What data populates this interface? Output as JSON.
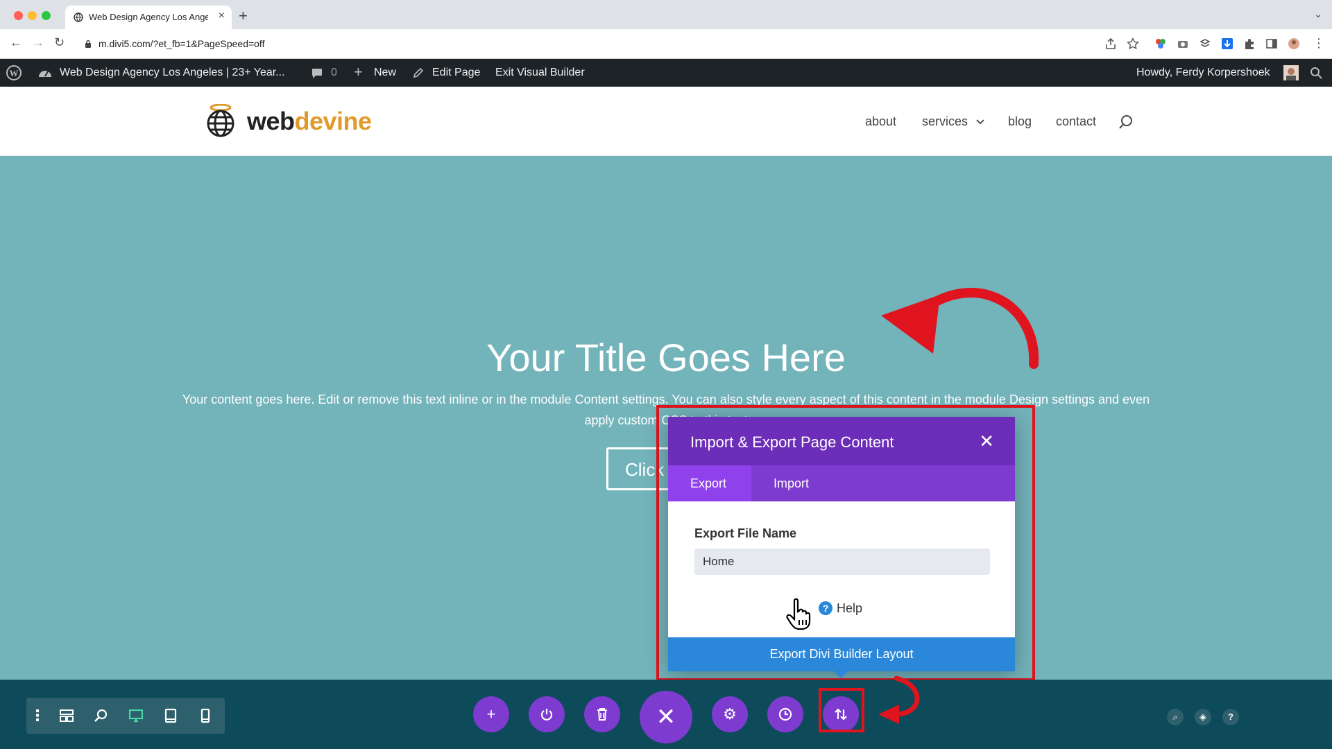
{
  "browser": {
    "tab_title": "Web Design Agency Los Angel",
    "url": "m.divi5.com/?et_fb=1&PageSpeed=off"
  },
  "wp_admin_bar": {
    "site_name": "Web Design Agency Los Angeles | 23+ Year...",
    "comments_count": "0",
    "new_label": "New",
    "edit_page_label": "Edit Page",
    "exit_vb_label": "Exit Visual Builder",
    "howdy": "Howdy, Ferdy Korpershoek"
  },
  "site": {
    "logo_part1": "web",
    "logo_part2": "devine",
    "nav": [
      "about",
      "services",
      "blog",
      "contact"
    ]
  },
  "hero": {
    "title": "Your Title Goes Here",
    "text": "Your content goes here. Edit or remove this text inline or in the module Content settings. You can also style every aspect of this content in the module Design settings and even apply custom CSS to this text",
    "button": "Click"
  },
  "modal": {
    "title": "Import & Export Page Content",
    "tabs": [
      {
        "label": "Export",
        "active": true
      },
      {
        "label": "Import",
        "active": false
      }
    ],
    "field_label": "Export File Name",
    "field_value": "Home",
    "help_label": "Help",
    "export_button": "Export Divi Builder Layout"
  },
  "colors": {
    "hero_bg": "#73b3ba",
    "modal_header": "#6c2eb9",
    "modal_tabs": "#7e3bd0",
    "modal_primary": "#2b87da",
    "divi_bar": "#0d4a5a",
    "annotation_red": "#e0141e",
    "logo_accent": "#e09a2a"
  },
  "icons": {
    "bottom_left": [
      "more-icon",
      "wireframe-icon",
      "zoom-icon",
      "desktop-icon",
      "tablet-icon",
      "phone-icon"
    ],
    "bottom_center": [
      "add-icon",
      "save-icon",
      "trash-icon",
      "close-icon",
      "settings-icon",
      "history-icon",
      "portability-icon"
    ],
    "bottom_right": [
      "search-icon",
      "layers-icon",
      "help-icon"
    ]
  }
}
